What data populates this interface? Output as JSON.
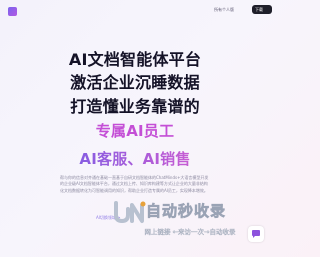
{
  "header": {
    "nav_personal": "所有个人版",
    "download_label": "下载"
  },
  "hero": {
    "line1": "AI文档智能体平台",
    "line2": "激活企业沉睡数据",
    "line3": "打造懂业务靠谱的",
    "line4": "专属AI员工",
    "line5": "AI客服、AI销售"
  },
  "description": {
    "text": "帮与你的信息对齐通在基础一直基于自研文档智能体的ChatMinds+大语言模型开发的企业级AI文档智能体平台，通过文档上传、知识库构建等方式让企业的大量非结构化文档数据转化为可智能调用的知识，帮助企业打造专属的AI员工，实现降本增效。",
    "link": "AI切换领域 >"
  },
  "watermark": {
    "title": "自动秒收录",
    "subtitle": "网上链接 ←来访一次→自动收录"
  },
  "colors": {
    "accent_purple": "#8d52dd",
    "accent_pink": "#c44fd6",
    "text_dark": "#141227"
  }
}
